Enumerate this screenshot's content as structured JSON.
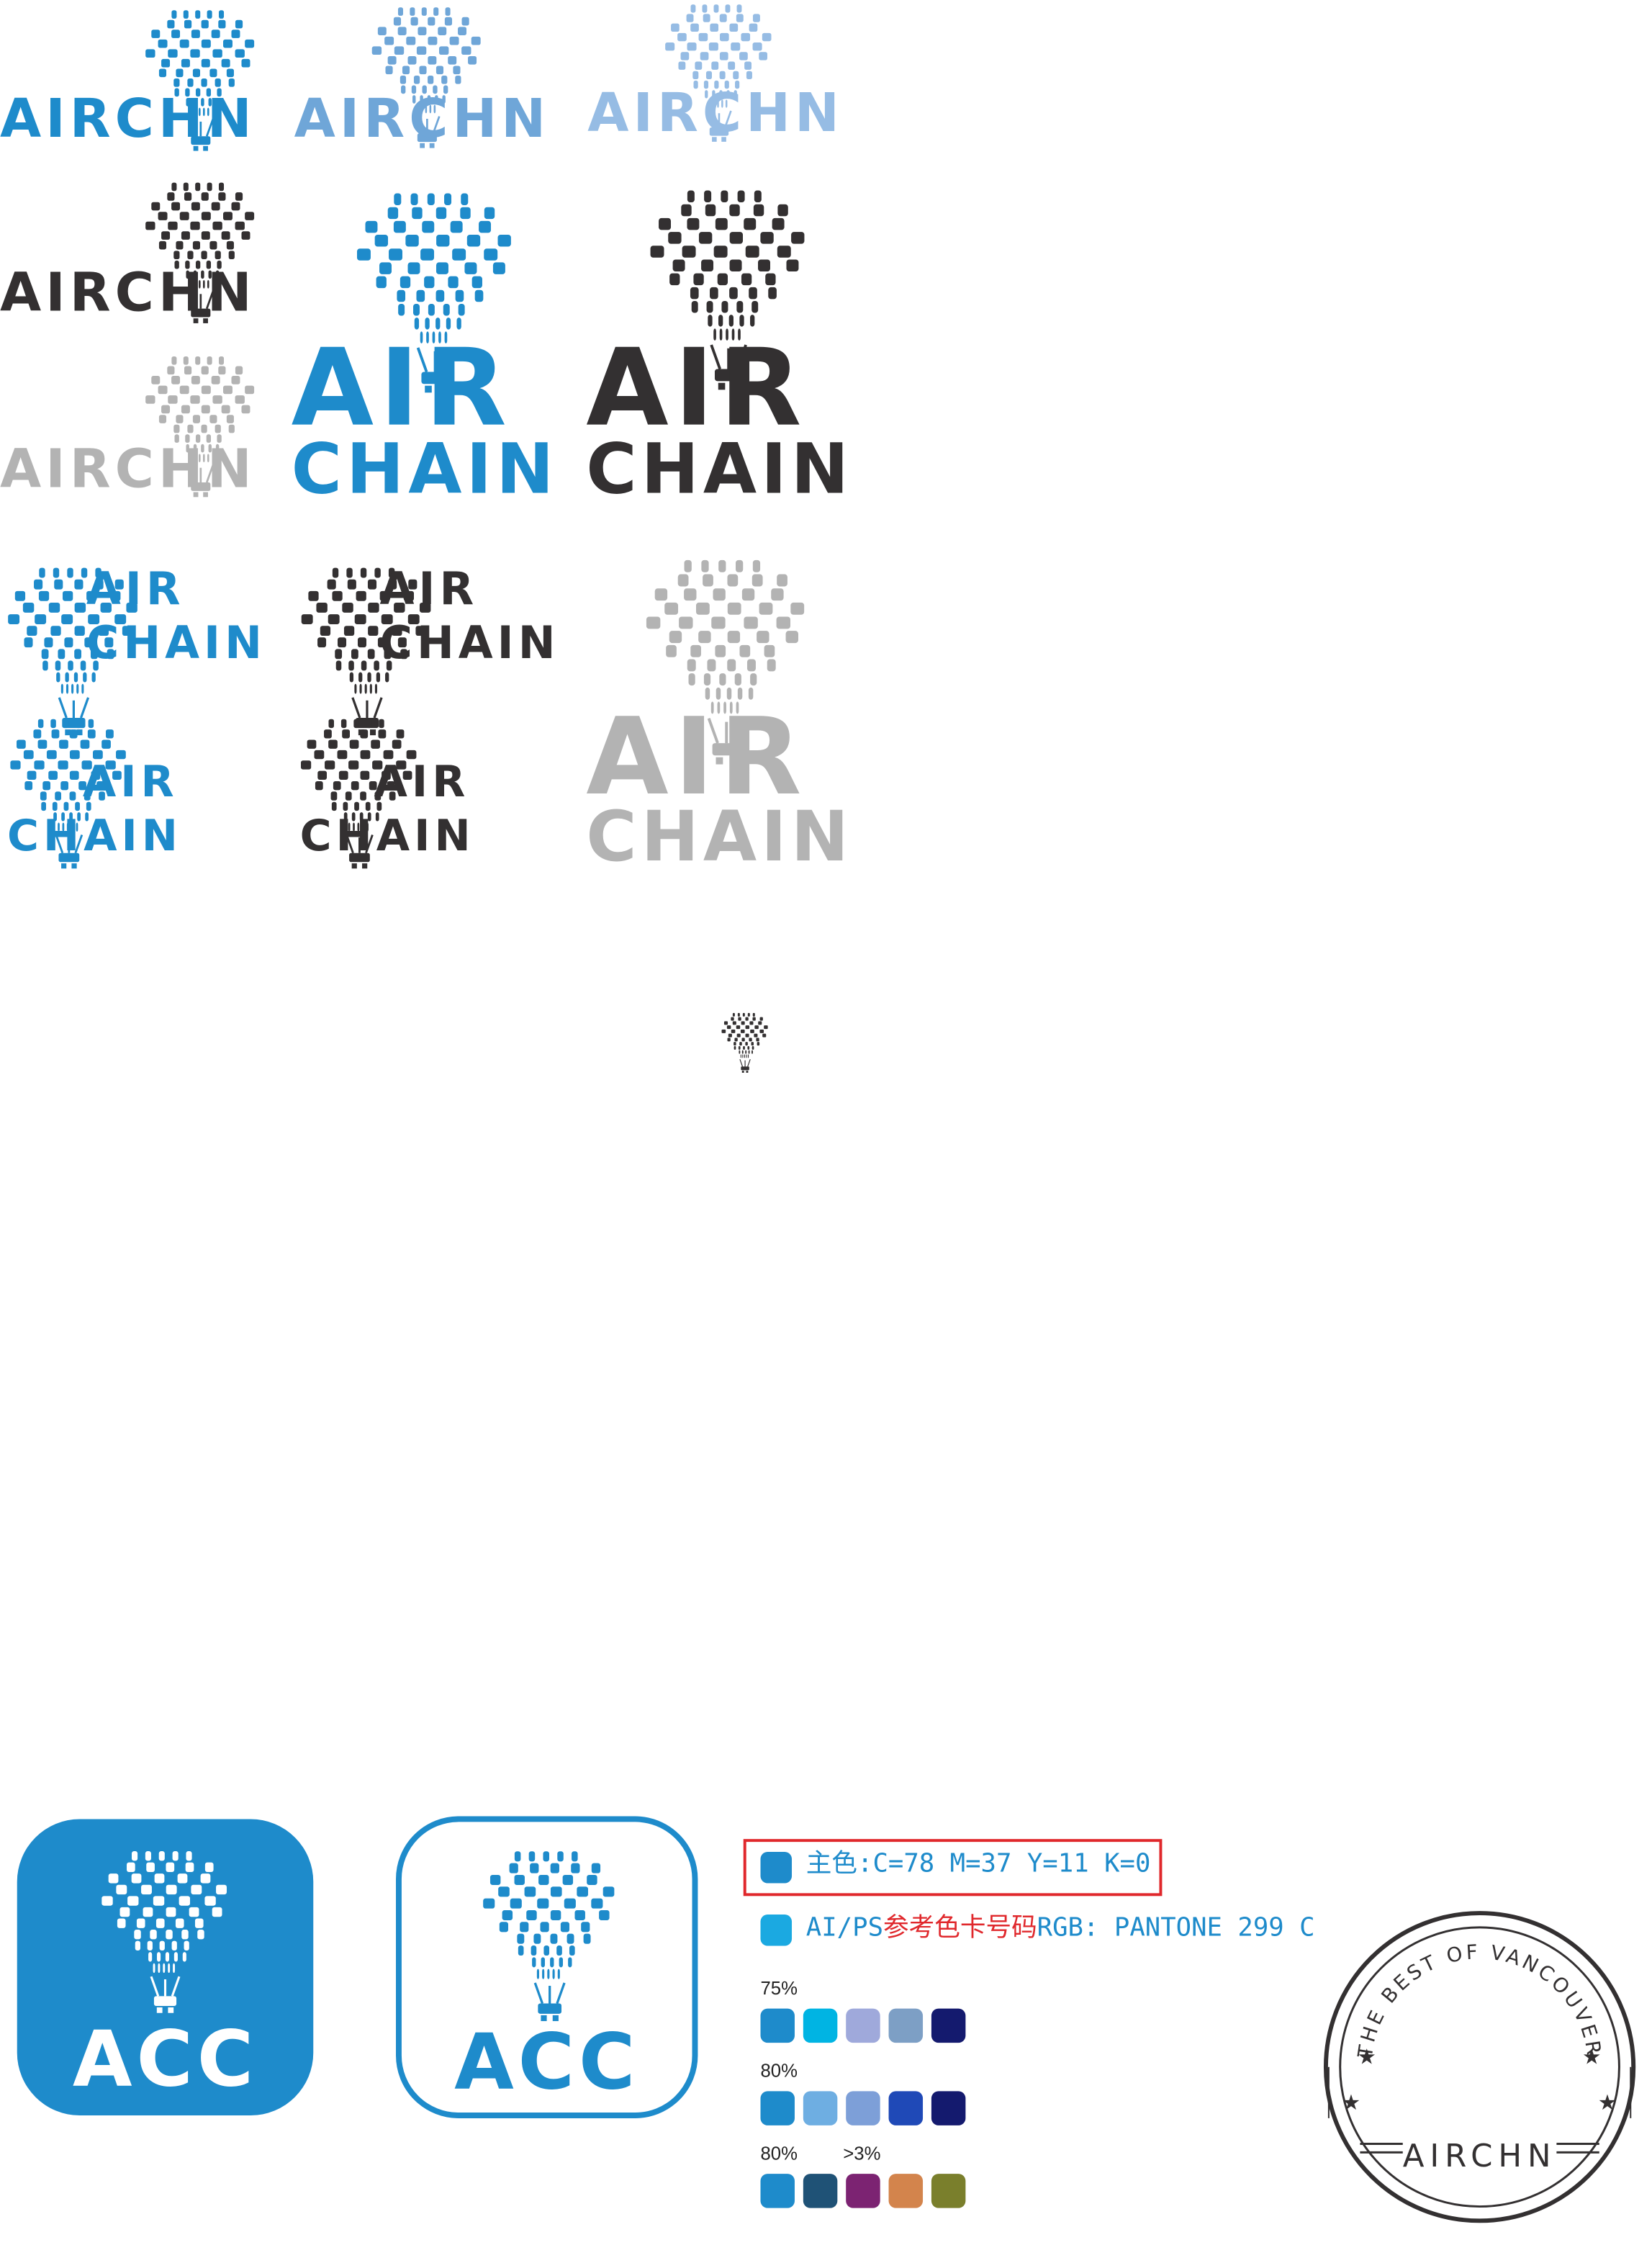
{
  "logos": {
    "short_name": "AIRCHN",
    "word_air": "AIR",
    "word_chain": "CHAIN",
    "app_label": "ACC"
  },
  "colors": {
    "blue": "#1e8bcb",
    "blue_mid": "#6fa6d8",
    "blue_light": "#96bce4",
    "dark": "#333031",
    "gray": "#b3b3b3"
  },
  "color_info": {
    "primary_line": "主色:C=78 M=37 Y=11 K=0",
    "pantone_line_prefix": "AI/PS",
    "pantone_line_cn": "参考色卡号码",
    "pantone_line_suffix": "RGB: PANTONE 299 C",
    "palettes": [
      {
        "label": "75%",
        "label2": "",
        "swatches": [
          "#1e8bcb",
          "#00b4e3",
          "#9fa9db",
          "#7d9fc5",
          "#141a6e"
        ]
      },
      {
        "label": "80%",
        "label2": "",
        "swatches": [
          "#1e8bcb",
          "#6eaee2",
          "#7d9fd8",
          "#1f49b7",
          "#141a6e"
        ]
      },
      {
        "label": "80%",
        "label2": ">3%",
        "swatches": [
          "#1e8bcb",
          "#1f5276",
          "#7c2372",
          "#d3844c",
          "#7a7f2c"
        ]
      }
    ]
  },
  "stamp": {
    "arc_text": "THE BEST OF VANCOUVER",
    "bottom_text": "AIRCHN"
  }
}
